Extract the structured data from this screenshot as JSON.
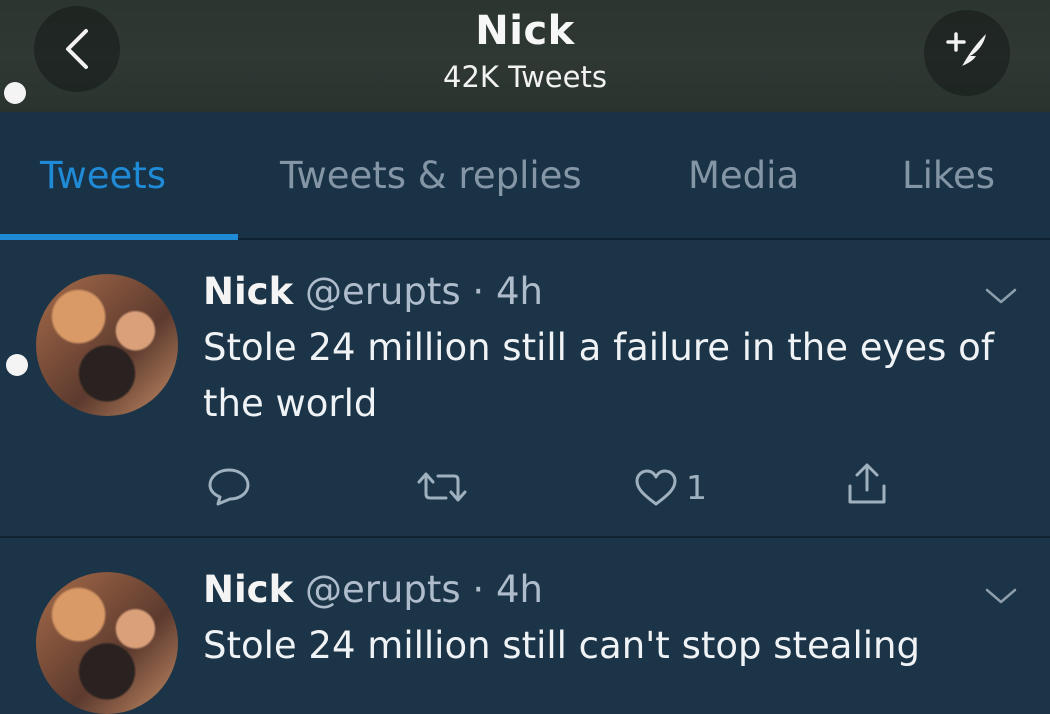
{
  "header": {
    "name": "Nick",
    "tweet_count": "42K Tweets"
  },
  "icons": {
    "back": "chevron-left",
    "compose": "compose-tweet",
    "reply": "reply-bubble",
    "retweet": "retweet-arrows",
    "like": "heart",
    "share": "share-upload",
    "more": "chevron-down"
  },
  "tabs": [
    {
      "label": "Tweets",
      "active": true
    },
    {
      "label": "Tweets & replies",
      "active": false
    },
    {
      "label": "Media",
      "active": false
    },
    {
      "label": "Likes",
      "active": false
    }
  ],
  "tweets": [
    {
      "name": "Nick",
      "handle": "@erupts",
      "time": "· 4h",
      "text": "Stole 24 million still a failure in the eyes of the world",
      "likes": "1"
    },
    {
      "name": "Nick",
      "handle": "@erupts",
      "time": "· 4h",
      "text": "Stole 24 million still can't stop stealing"
    }
  ],
  "colors": {
    "accent": "#1f8ad6",
    "background": "#1c3447",
    "header": "#2f3833"
  }
}
